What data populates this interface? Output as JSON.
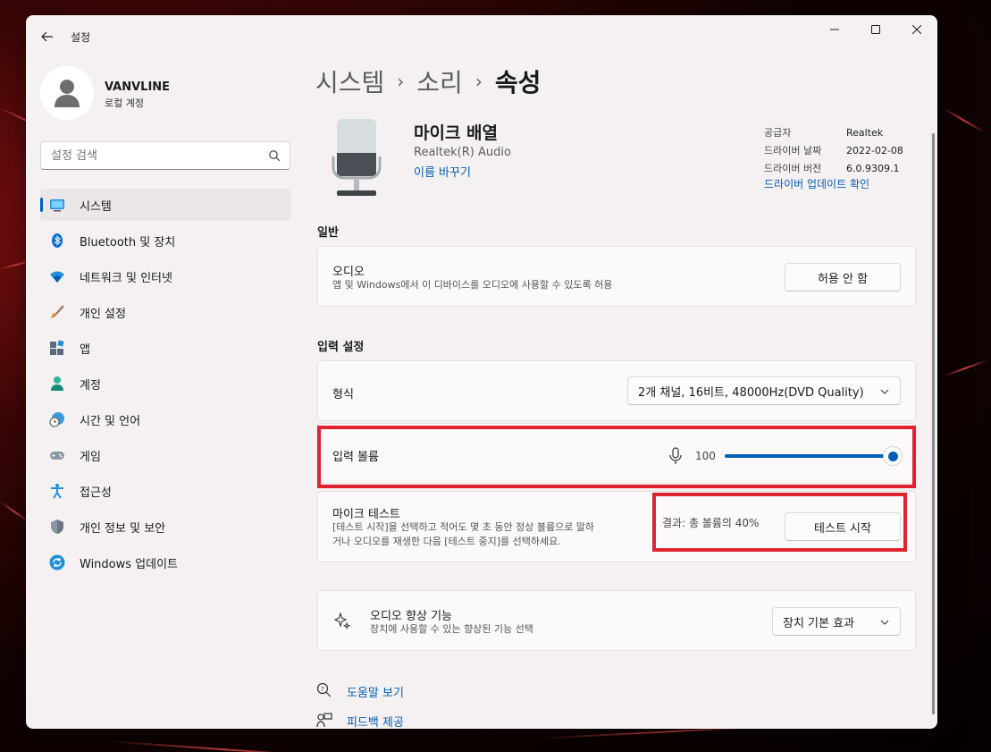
{
  "window": {
    "app_title": "설정"
  },
  "user": {
    "name": "VANVLINE",
    "account_type": "로컬 계정"
  },
  "search": {
    "placeholder": "설정 검색"
  },
  "sidebar": {
    "items": [
      {
        "label": "시스템",
        "icon": "system-monitor-icon",
        "active": true
      },
      {
        "label": "Bluetooth 및 장치",
        "icon": "bluetooth-icon"
      },
      {
        "label": "네트워크 및 인터넷",
        "icon": "wifi-icon"
      },
      {
        "label": "개인 설정",
        "icon": "paintbrush-icon"
      },
      {
        "label": "앱",
        "icon": "apps-icon"
      },
      {
        "label": "계정",
        "icon": "person-icon"
      },
      {
        "label": "시간 및 언어",
        "icon": "clock-globe-icon"
      },
      {
        "label": "게임",
        "icon": "gamepad-icon"
      },
      {
        "label": "접근성",
        "icon": "accessibility-icon"
      },
      {
        "label": "개인 정보 및 보안",
        "icon": "shield-icon"
      },
      {
        "label": "Windows 업데이트",
        "icon": "update-icon"
      }
    ]
  },
  "breadcrumb": {
    "level1": "시스템",
    "level2": "소리",
    "current": "속성"
  },
  "device": {
    "name": "마이크 배열",
    "subtitle": "Realtek(R) Audio",
    "rename_link": "이름 바꾸기",
    "info": [
      {
        "label": "공급자",
        "value": "Realtek"
      },
      {
        "label": "드라이버 날짜",
        "value": "2022-02-08"
      },
      {
        "label": "드라이버 버전",
        "value": "6.0.9309.1"
      }
    ],
    "driver_update_link": "드라이버 업데이트 확인"
  },
  "general": {
    "section_title": "일반",
    "audio_title": "오디오",
    "audio_desc": "앱 및 Windows에서 이 디바이스를 오디오에 사용할 수 있도록 허용",
    "audio_button": "허용 안 함"
  },
  "input_settings": {
    "section_title": "입력 설정",
    "format_label": "형식",
    "format_value": "2개 채널, 16비트, 48000Hz(DVD Quality)",
    "volume_label": "입력 볼륨",
    "volume_value": "100",
    "volume_level_percent": 100,
    "mic_test_title": "마이크 테스트",
    "mic_test_desc_line1": "[테스트 시작]을 선택하고 적어도 몇 초 동안 정상 볼륨으로 말하",
    "mic_test_desc_line2": "거나 오디오를 재생한 다음 [테스트 중지]를 선택하세요.",
    "mic_test_result": "결과: 총 볼륨의 40%",
    "mic_test_button": "테스트 시작"
  },
  "enhancements": {
    "title": "오디오 향상 기능",
    "desc": "장치에 사용할 수 있는 향상된 기능 선택",
    "dropdown_value": "장치 기본 효과"
  },
  "footer": {
    "help_link": "도움말 보기",
    "feedback_link": "피드백 제공"
  },
  "colors": {
    "accent": "#005fb8",
    "highlight": "#e0232e"
  }
}
